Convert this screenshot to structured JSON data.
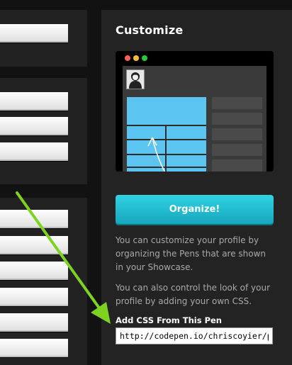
{
  "sidebar": {
    "title": "Customize",
    "preview": {
      "window_dots": [
        "#ff5f57",
        "#febc2e",
        "#28c840"
      ],
      "avatar_icon": "user-avatar-icon",
      "accent_color": "#5bc4f0"
    },
    "organize_button": {
      "label": "Organize!",
      "color": "#1fbcd2"
    },
    "description_1": "You can customize your profile by organizing the Pens that are shown in your Showcase.",
    "description_2": "You can also control the look of your profile by adding your own CSS.",
    "css_field": {
      "label": "Add CSS From This Pen",
      "value": "http://codepen.io/chriscoyier/pen/"
    }
  },
  "annotation": {
    "arrow_color": "#7ed321",
    "arrow_icon": "green-arrow-icon"
  }
}
